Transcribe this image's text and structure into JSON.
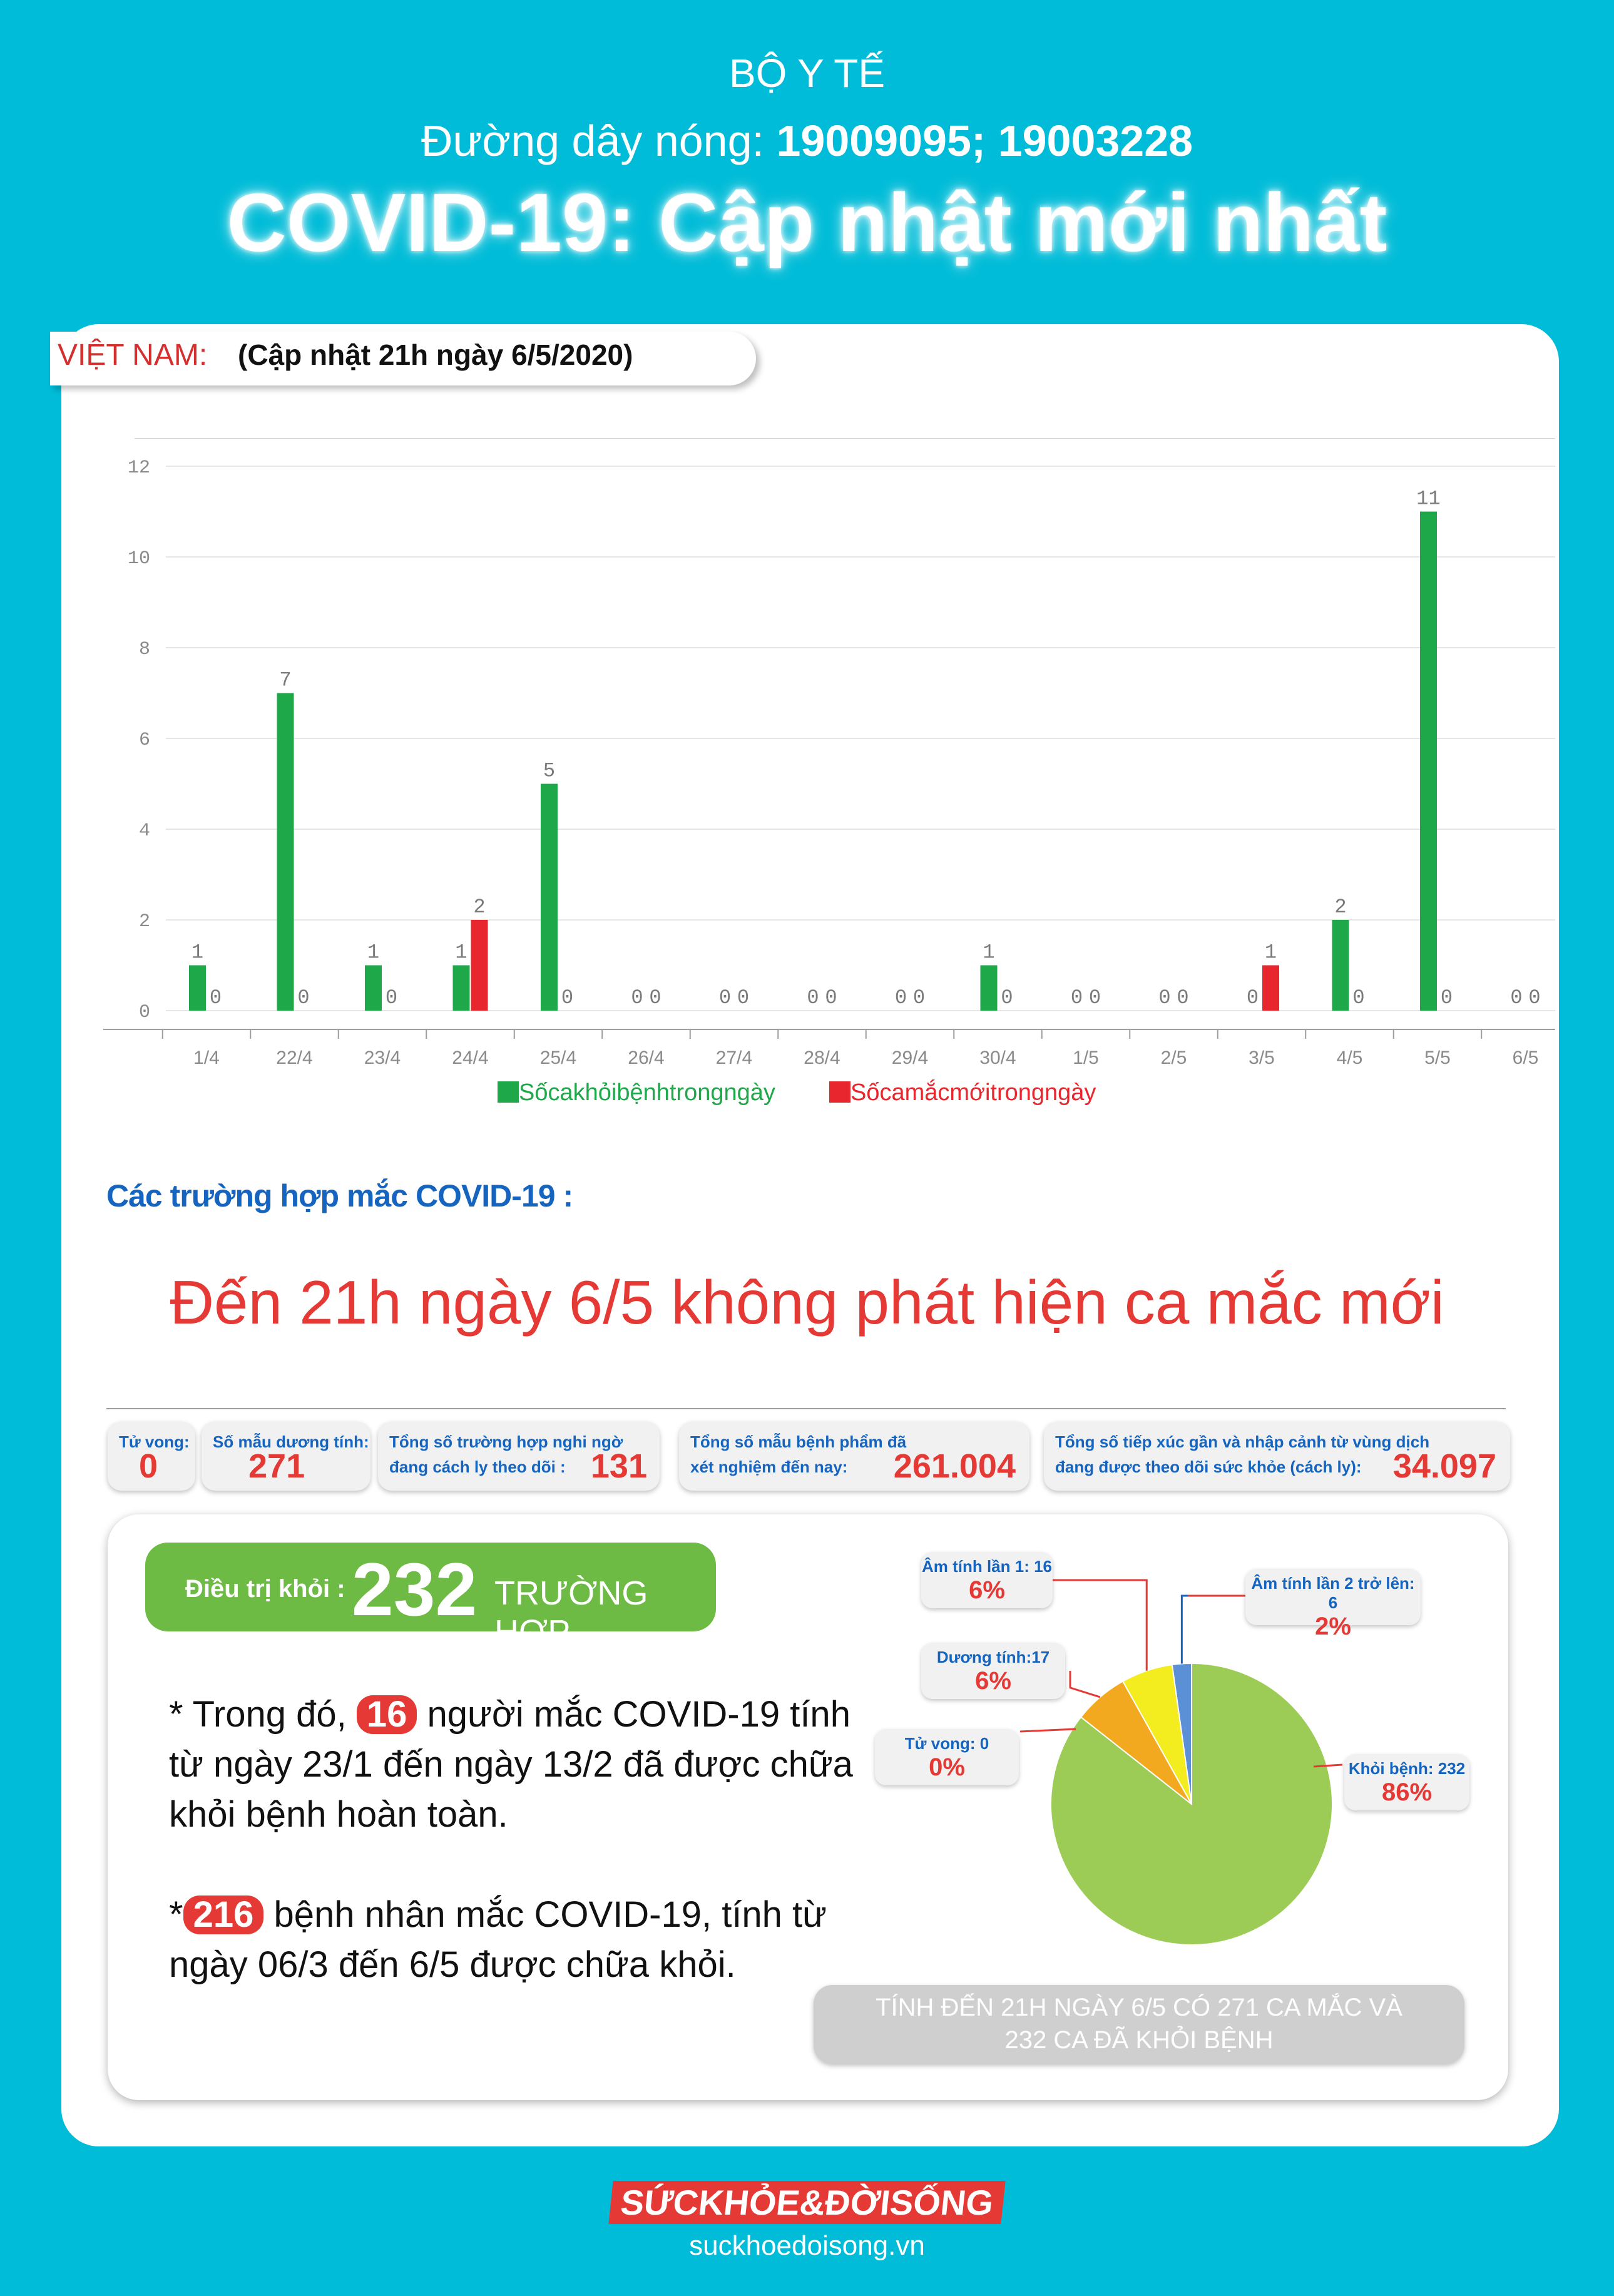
{
  "header": {
    "org": "BỘ Y TẾ",
    "hotline_label": "Đường dây nóng:",
    "hotline_numbers": "19009095; 19003228",
    "title": "COVID-19: Cập nhật mới nhất"
  },
  "vietnam": {
    "label": "VIỆT NAM:",
    "update": "(Cập nhật 21h ngày 6/5/2020)"
  },
  "chart_data": {
    "type": "bar",
    "categories": [
      "1/4",
      "22/4",
      "23/4",
      "24/4",
      "25/4",
      "26/4",
      "27/4",
      "28/4",
      "29/4",
      "30/4",
      "1/5",
      "2/5",
      "3/5",
      "4/5",
      "5/5",
      "6/5"
    ],
    "series": [
      {
        "name": "Sốcakhỏibệnhtrongngày",
        "color": "#1fa84a",
        "values": [
          1,
          7,
          1,
          1,
          5,
          0,
          0,
          0,
          0,
          1,
          0,
          0,
          0,
          2,
          11,
          0
        ]
      },
      {
        "name": "Sốcamắcmớitrongngày",
        "color": "#e8262d",
        "values": [
          0,
          0,
          0,
          2,
          0,
          0,
          0,
          0,
          0,
          0,
          0,
          0,
          1,
          0,
          0,
          0
        ]
      }
    ],
    "ylim": [
      0,
      12
    ],
    "yticks": [
      "0",
      "2",
      "4",
      "6",
      "8",
      "10",
      "12"
    ],
    "grid": true,
    "legend": "bottom"
  },
  "cases_section": {
    "title": "Các trường hợp mắc COVID-19 :",
    "headline": "Đến 21h ngày 6/5 không phát hiện ca mắc mới"
  },
  "stats": [
    {
      "l1": "Tử vong:",
      "l2": "",
      "value": "0"
    },
    {
      "l1": "Số mẫu dương tính:",
      "l2": "",
      "value": "271"
    },
    {
      "l1": "Tổng số trường hợp nghi ngờ",
      "l2": "đang cách ly theo dõi :",
      "value": "131"
    },
    {
      "l1": "Tổng số mẫu bệnh phẩm đã",
      "l2": "xét nghiệm đến nay:",
      "value": "261.004"
    },
    {
      "l1": "Tổng số tiếp xúc gần và nhập cảnh từ vùng dịch",
      "l2": "đang được theo dõi sức khỏe (cách ly):",
      "value": "34.097"
    }
  ],
  "recovered": {
    "label": "Điều trị khỏi :",
    "value": "232",
    "unit": "TRƯỜNG HỢP",
    "p1_a": "* Trong đó,",
    "p1_num": "16",
    "p1_b": "người mắc COVID-19 tính",
    "p1_c": "từ ngày 23/1 đến ngày 13/2 đã được chữa",
    "p1_d": "khỏi bệnh hoàn toàn.",
    "p2_a": "*",
    "p2_num": "216",
    "p2_b": "bệnh nhân  mắc COVID-19, tính từ",
    "p2_c": "ngày 06/3 đến 6/5 được chữa khỏi."
  },
  "pie": {
    "slices": [
      {
        "name": "Khỏi bệnh: 232",
        "pct": "86%",
        "value": 232,
        "color": "#9ccb56"
      },
      {
        "name": "Dương tính:17",
        "pct": "6%",
        "value": 17,
        "color": "#f2a81f"
      },
      {
        "name": "Âm tính lần 1: 16",
        "pct": "6%",
        "value": 16,
        "color": "#f3ec1e"
      },
      {
        "name": "Âm tính lần 2 trở lên: 6",
        "pct": "2%",
        "value": 6,
        "color": "#5b8fd6"
      },
      {
        "name": "Tử vong: 0",
        "pct": "0%",
        "value": 0,
        "color": "#ffffff"
      }
    ]
  },
  "note": {
    "line1": "TÍNH ĐẾN 21H NGÀY 6/5 CÓ 271 CA MẮC VÀ",
    "line2": "232 CA ĐÃ KHỎI BỆNH"
  },
  "logo": {
    "text": "SỨCKHỎE&ĐỜISỐNG",
    "url": "suckhoedoisong.vn"
  }
}
